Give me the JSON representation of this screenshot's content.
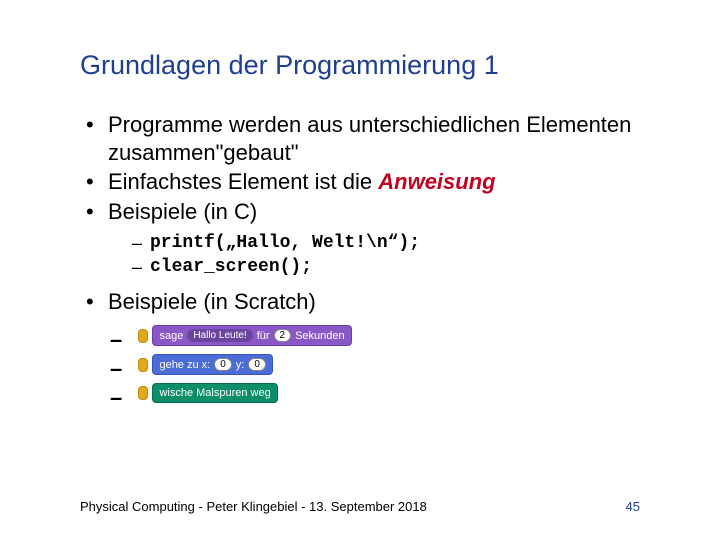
{
  "title": "Grundlagen der Programmierung   1",
  "bullets": {
    "b1": "Programme werden aus unterschiedlichen Elementen zusammen\"gebaut\"",
    "b2a": "Einfachstes Element ist die ",
    "b2b": "Anweisung",
    "b3": "Beispiele (in C)",
    "b4": "Beispiele (in Scratch)"
  },
  "code": {
    "c1": "printf(„Hallo, Welt!\\n“);",
    "c2": "clear_screen();"
  },
  "scratch": {
    "s1": {
      "sage": "sage",
      "text": "Hallo Leute!",
      "fuer": "für",
      "num": "2",
      "sek": "Sekunden"
    },
    "s2": {
      "gehe": "gehe  zu  x:",
      "x": "0",
      "ylab": "y:",
      "y": "0"
    },
    "s3": {
      "wische": "wische  Malspuren  weg"
    }
  },
  "footer": {
    "left": "Physical Computing -   Peter Klingebiel  -  13. September 2018",
    "page": "45"
  }
}
